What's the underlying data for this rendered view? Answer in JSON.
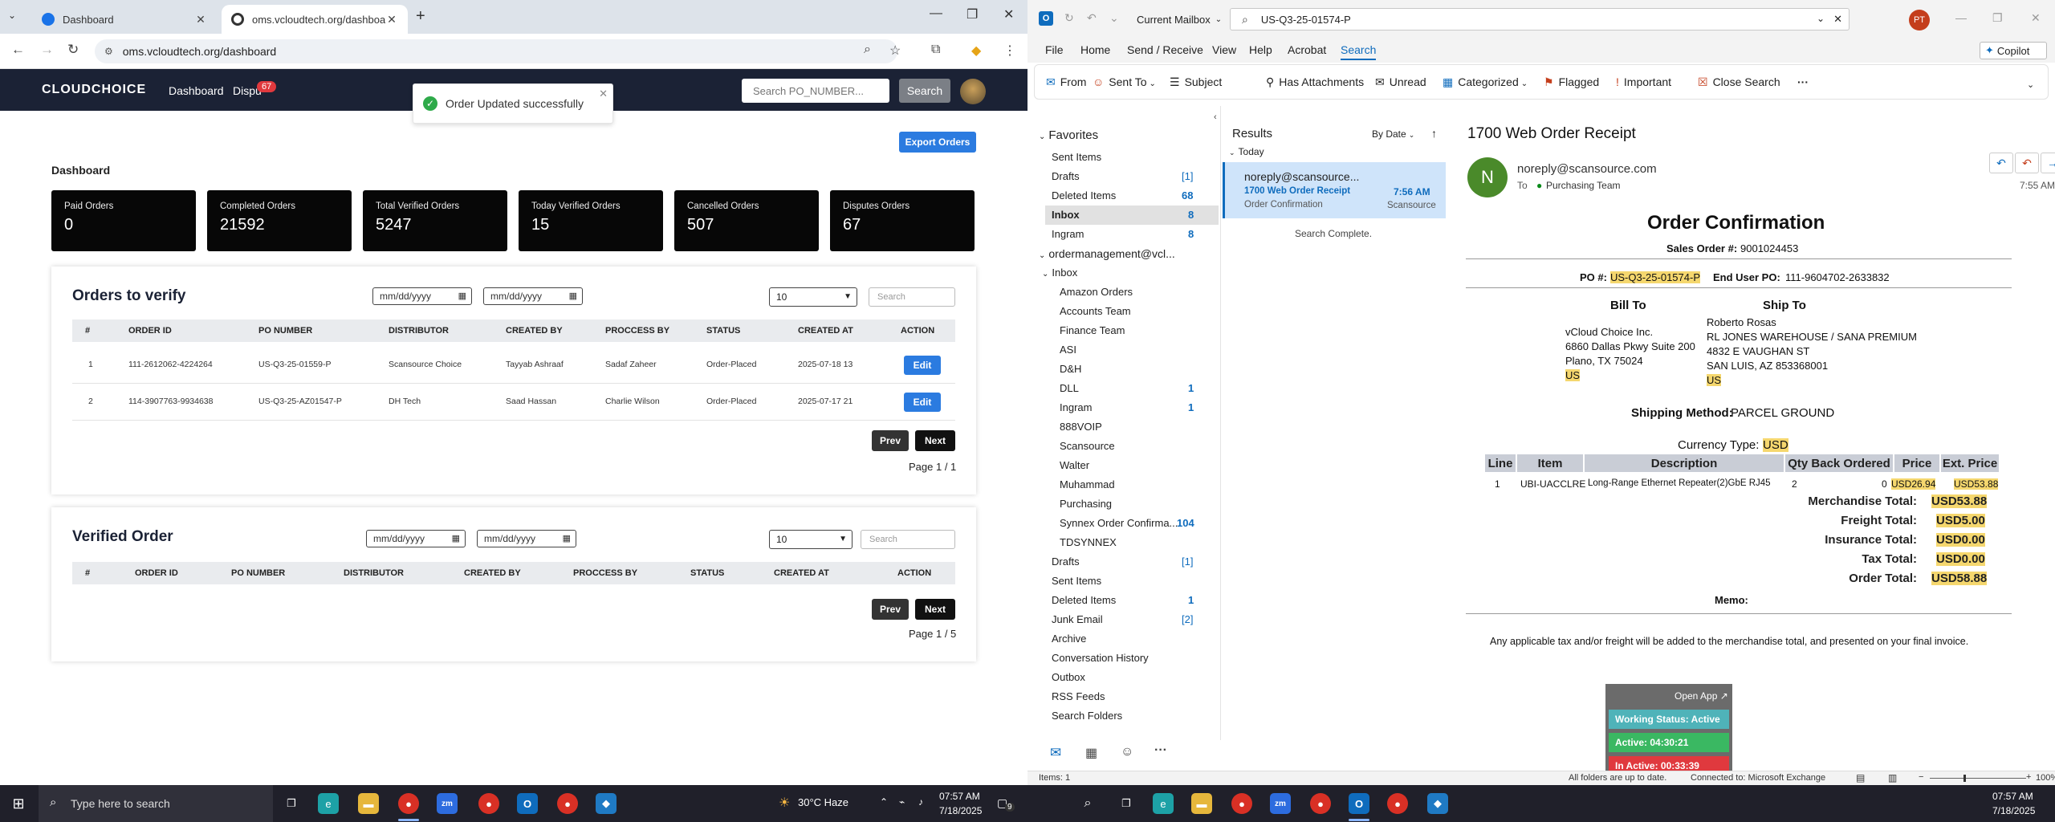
{
  "chrome": {
    "tabs": [
      {
        "title": "Dashboard"
      },
      {
        "title": "oms.vcloudtech.org/dashboard"
      }
    ],
    "url": "oms.vcloudtech.org/dashboard"
  },
  "app": {
    "logo": "CLOUDCHOICE",
    "nav": {
      "dashboard": "Dashboard",
      "disputes": "Dispu",
      "disputes_badge": "67"
    },
    "search_placeholder": "Search PO_NUMBER...",
    "search_button": "Search",
    "toast": "Order Updated successfully",
    "export_button": "Export Orders",
    "page_title": "Dashboard",
    "stats": [
      {
        "label": "Paid Orders",
        "value": "0"
      },
      {
        "label": "Completed Orders",
        "value": "21592"
      },
      {
        "label": "Total Verified Orders",
        "value": "5247"
      },
      {
        "label": "Today Verified Orders",
        "value": "15"
      },
      {
        "label": "Cancelled Orders",
        "value": "507"
      },
      {
        "label": "Disputes Orders",
        "value": "67"
      }
    ],
    "verify": {
      "title": "Orders to verify",
      "date_placeholder": "mm/dd/yyyy",
      "page_size": "10",
      "search_placeholder": "Search",
      "columns": [
        "#",
        "ORDER ID",
        "PO NUMBER",
        "DISTRIBUTOR",
        "CREATED BY",
        "PROCCESS BY",
        "STATUS",
        "CREATED AT",
        "ACTION"
      ],
      "rows": [
        {
          "num": "1",
          "order_id": "111-2612062-4224264",
          "po": "US-Q3-25-01559-P",
          "distributor": "Scansource Choice",
          "created_by": "Tayyab Ashraaf",
          "processed_by": "Sadaf Zaheer",
          "status": "Order-Placed",
          "created_at": "2025-07-18 13",
          "action": "Edit"
        },
        {
          "num": "2",
          "order_id": "114-3907763-9934638",
          "po": "US-Q3-25-AZ01547-P",
          "distributor": "DH Tech",
          "created_by": "Saad Hassan",
          "processed_by": "Charlie Wilson",
          "status": "Order-Placed",
          "created_at": "2025-07-17 21",
          "action": "Edit"
        }
      ],
      "prev": "Prev",
      "next": "Next",
      "page_info": "Page 1 / 1"
    },
    "verified": {
      "title": "Verified Order",
      "date_placeholder": "mm/dd/yyyy",
      "page_size": "10",
      "search_placeholder": "Search",
      "columns": [
        "#",
        "ORDER ID",
        "PO NUMBER",
        "DISTRIBUTOR",
        "CREATED BY",
        "PROCCESS BY",
        "STATUS",
        "CREATED AT",
        "ACTION"
      ],
      "prev": "Prev",
      "next": "Next",
      "page_info": "Page 1 / 5"
    }
  },
  "outlook": {
    "mailbox_scope": "Current Mailbox",
    "search_query": "US-Q3-25-01574-P",
    "avatar_initials": "PT",
    "menu": [
      "File",
      "Home",
      "Send / Receive",
      "View",
      "Help",
      "Acrobat",
      "Search"
    ],
    "copilot": "Copilot",
    "ribbon": [
      "From",
      "Sent To",
      "Subject",
      "Has Attachments",
      "Unread",
      "Categorized",
      "Flagged",
      "Important",
      "Close Search"
    ],
    "favorites_label": "Favorites",
    "favorites": [
      {
        "name": "Sent Items",
        "count": ""
      },
      {
        "name": "Drafts",
        "count": "[1]"
      },
      {
        "name": "Deleted Items",
        "count": "68"
      },
      {
        "name": "Inbox",
        "count": "8"
      },
      {
        "name": "Ingram",
        "count": "8"
      }
    ],
    "account": "ordermanagement@vcl...",
    "inbox_label": "Inbox",
    "inbox_subfolders": [
      {
        "name": "Amazon Orders",
        "count": ""
      },
      {
        "name": "Accounts Team",
        "count": ""
      },
      {
        "name": "Finance Team",
        "count": ""
      },
      {
        "name": "ASI",
        "count": ""
      },
      {
        "name": "D&H",
        "count": ""
      },
      {
        "name": "DLL",
        "count": "1"
      },
      {
        "name": "Ingram",
        "count": "1"
      },
      {
        "name": "888VOIP",
        "count": ""
      },
      {
        "name": "Scansource",
        "count": ""
      },
      {
        "name": "Walter",
        "count": ""
      },
      {
        "name": "Muhammad",
        "count": ""
      },
      {
        "name": "Purchasing",
        "count": ""
      },
      {
        "name": "Synnex Order Confirma...",
        "count": "104"
      },
      {
        "name": "TDSYNNEX",
        "count": ""
      }
    ],
    "account_folders": [
      {
        "name": "Drafts",
        "count": "[1]"
      },
      {
        "name": "Sent Items",
        "count": ""
      },
      {
        "name": "Deleted Items",
        "count": "1"
      },
      {
        "name": "Junk Email",
        "count": "[2]"
      },
      {
        "name": "Archive",
        "count": ""
      },
      {
        "name": "Conversation History",
        "count": ""
      },
      {
        "name": "Outbox",
        "count": ""
      },
      {
        "name": "RSS Feeds",
        "count": ""
      },
      {
        "name": "Search Folders",
        "count": ""
      }
    ],
    "results": {
      "title": "Results",
      "sort": "By Date",
      "group": "Today",
      "message": {
        "from": "noreply@scansource...",
        "subject": "1700 Web Order Receipt",
        "time": "7:56 AM",
        "preview": "Order Confirmation",
        "folder": "Scansource"
      },
      "complete": "Search Complete."
    },
    "reading": {
      "subject": "1700 Web Order Receipt",
      "from": "noreply@scansource.com",
      "to_label": "To",
      "to": "Purchasing Team",
      "avatar": "N",
      "time": "7:55 AM",
      "doc_title": "Order Confirmation",
      "sales_order_label": "Sales Order #:",
      "sales_order": "9001024453",
      "po_label": "PO #:",
      "po": "US-Q3-25-01574-P",
      "end_user_po_label": "End User PO:",
      "end_user_po": "111-9604702-2633832",
      "bill_to_label": "Bill To",
      "ship_to_label": "Ship To",
      "bill_to": [
        "vCloud Choice Inc.",
        "6860 Dallas Pkwy Suite 200",
        "Plano, TX 75024",
        "US"
      ],
      "ship_to": [
        "Roberto Rosas",
        "RL JONES WAREHOUSE / SANA PREMIUM",
        "4832 E VAUGHAN ST",
        "SAN LUIS, AZ 853368001",
        "US"
      ],
      "shipping_method_label": "Shipping Method:",
      "shipping_method": "PARCEL GROUND",
      "currency_label": "Currency Type:",
      "currency": "USD",
      "line_headers": [
        "Line",
        "Item",
        "Description",
        "Qty Back Ordered",
        "Price",
        "Ext. Price"
      ],
      "line": {
        "line": "1",
        "item": "UBI-UACCLRE",
        "description": "Long-Range Ethernet Repeater(2)GbE RJ45",
        "qty": "2",
        "back_ordered": "0",
        "price": "USD26.94",
        "ext_price": "USD53.88"
      },
      "totals": [
        {
          "label": "Merchandise Total:",
          "value": "USD53.88"
        },
        {
          "label": "Freight Total:",
          "value": "USD5.00"
        },
        {
          "label": "Insurance Total:",
          "value": "USD0.00"
        },
        {
          "label": "Tax Total:",
          "value": "USD0.00"
        },
        {
          "label": "Order Total:",
          "value": "USD58.88"
        }
      ],
      "memo_label": "Memo:",
      "footer_note": "Any applicable tax and/or freight will be added to the merchandise total, and presented on your final invoice."
    },
    "status_widget": {
      "open_app": "Open App",
      "working": "Working Status: Active",
      "active": "Active: 04:30:21",
      "inactive": "In Active: 00:33:39"
    },
    "statusbar": {
      "items": "Items: 1",
      "sync": "All folders are up to date.",
      "connection": "Connected to: Microsoft Exchange",
      "zoom": "100%"
    }
  },
  "taskbar": {
    "search_placeholder": "Type here to search",
    "weather": "30°C  Haze",
    "time": "07:57 AM",
    "date": "7/18/2025",
    "notif_count": "9",
    "time2": "07:57 AM",
    "date2": "7/18/2025"
  }
}
